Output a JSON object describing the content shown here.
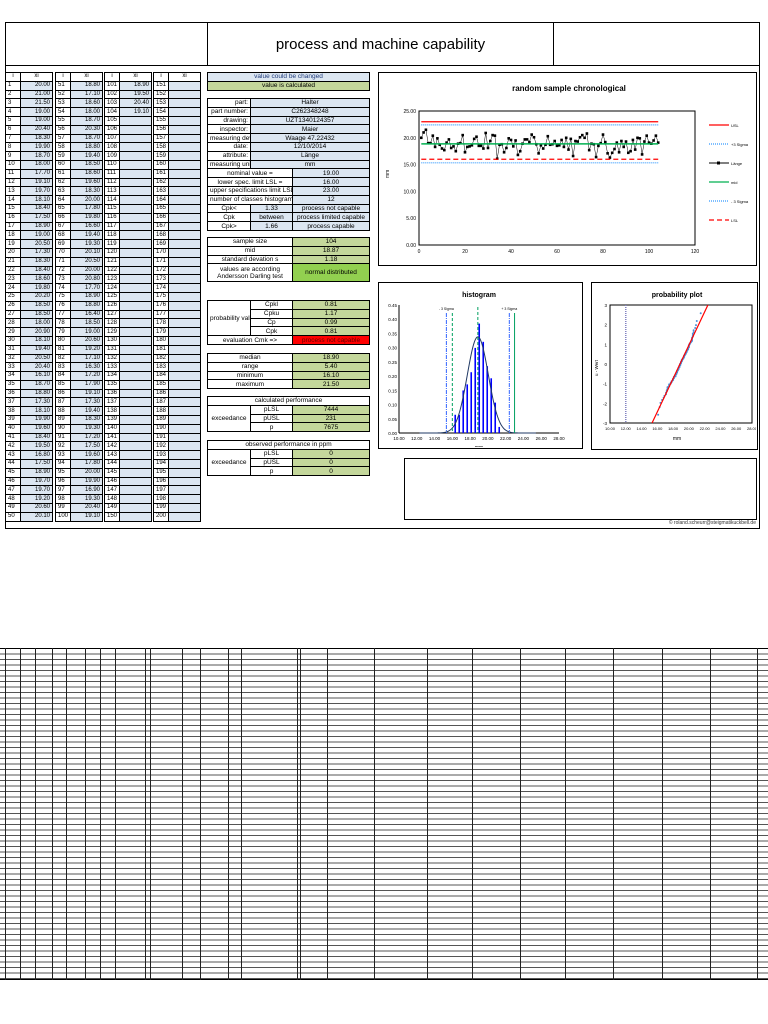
{
  "title": "process and machine capability",
  "table_headers": {
    "i": "i",
    "xi": "xi"
  },
  "measurements": [
    "20.00",
    "21.00",
    "21.50",
    "19.00",
    "19.00",
    "20.40",
    "18.30",
    "19.90",
    "18.70",
    "18.00",
    "17.70",
    "19.10",
    "19.70",
    "18.10",
    "18.40",
    "17.50",
    "18.90",
    "19.00",
    "20.50",
    "17.30",
    "18.30",
    "18.40",
    "18.60",
    "19.80",
    "20.20",
    "18.50",
    "18.50",
    "18.00",
    "20.90",
    "18.10",
    "19.40",
    "20.50",
    "20.40",
    "16.10",
    "18.70",
    "18.80",
    "17.30",
    "18.10",
    "19.90",
    "19.60",
    "18.40",
    "19.50",
    "16.80",
    "17.50",
    "18.90",
    "19.70",
    "19.70",
    "19.20",
    "20.60",
    "20.10",
    "18.80",
    "17.10",
    "18.60",
    "18.00",
    "18.70",
    "20.30",
    "18.70",
    "18.80",
    "19.40",
    "18.50",
    "18.60",
    "19.60",
    "18.30",
    "20.00",
    "17.80",
    "19.80",
    "16.60",
    "19.40",
    "19.30",
    "20.10",
    "20.50",
    "20.00",
    "20.80",
    "17.70",
    "18.90",
    "18.80",
    "16.40",
    "18.50",
    "19.00",
    "20.60",
    "19.20",
    "17.10",
    "16.30",
    "17.20",
    "17.90",
    "19.10",
    "17.30",
    "19.40",
    "18.30",
    "19.30",
    "17.20",
    "17.50",
    "19.60",
    "17.80",
    "20.00",
    "19.90",
    "16.90",
    "19.30",
    "20.40",
    "19.10",
    "18.90",
    "19.50",
    "20.40",
    "19.10"
  ],
  "legend_box": {
    "changeable": "value could be changed",
    "calculated": "value is calculated"
  },
  "part_info": [
    {
      "label": "part:",
      "value": "Halter"
    },
    {
      "label": "part number:",
      "value": "C262348248"
    },
    {
      "label": "drawing:",
      "value": "UZT1340124357"
    },
    {
      "label": "inspector:",
      "value": "Maier"
    },
    {
      "label": "measuring device:",
      "value": "Waage 47.22432"
    },
    {
      "label": "date:",
      "value": "12/10/2014"
    },
    {
      "label": "attribute:",
      "value": "Länge"
    },
    {
      "label": "measuring unit:",
      "value": "mm"
    }
  ],
  "spec": [
    {
      "label": "nominal value =",
      "value": "19.00"
    },
    {
      "label": "lower spec. limit LSL =",
      "value": "16.00"
    },
    {
      "label": "upper specifications limit LSL =",
      "value": "23.00"
    },
    {
      "label": "number of classes histogram =",
      "value": "12"
    }
  ],
  "cpk_eval": [
    {
      "label": "Cpk<",
      "value": "1.33",
      "result": "process not capable"
    },
    {
      "label": "Cpk",
      "value": "between",
      "result": "process limited capable"
    },
    {
      "label": "Cpk>",
      "value": "1.66",
      "result": "process capable"
    }
  ],
  "stats": [
    {
      "label": "sample size",
      "value": "104"
    },
    {
      "label": "mid",
      "value": "18.87"
    },
    {
      "label": "standard devation s",
      "value": "1.18"
    }
  ],
  "distribution": {
    "label": "values are according Andersson Darling test",
    "value": "normal distributed"
  },
  "probability_values": {
    "group_label": "probability values",
    "rows": [
      {
        "label": "Cpkl",
        "value": "0.81"
      },
      {
        "label": "Cpku",
        "value": "1.17"
      },
      {
        "label": "Cp",
        "value": "0.99"
      },
      {
        "label": "Cpk",
        "value": "0.81"
      }
    ]
  },
  "evaluation": {
    "label": "evaluation Cmk =>",
    "value": "process not capable"
  },
  "summary": [
    {
      "label": "median",
      "value": "18.90"
    },
    {
      "label": "range",
      "value": "5.40"
    },
    {
      "label": "minimum",
      "value": "16.10"
    },
    {
      "label": "maximum",
      "value": "21.50"
    }
  ],
  "calculated_performance": {
    "title": "calculated performance",
    "group_label": "exceedance",
    "rows": [
      {
        "label": "pLSL",
        "value": "7444"
      },
      {
        "label": "pUSL",
        "value": "231"
      },
      {
        "label": "p",
        "value": "7675"
      }
    ]
  },
  "observed_performance": {
    "title": "observed performance in ppm",
    "group_label": "exceedance",
    "rows": [
      {
        "label": "pLSL",
        "value": "0"
      },
      {
        "label": "pUSL",
        "value": "0"
      },
      {
        "label": "p",
        "value": "0"
      }
    ]
  },
  "copyright": "© roland.scheurr@steigmatikuckbell.de",
  "colors": {
    "input": "#dce6f1",
    "calculated": "#c4d79b",
    "ok": "#92d050",
    "bad": "#ff0000"
  },
  "chart_data": [
    {
      "type": "line",
      "title": "random sample chronological",
      "ylabel": "mm",
      "xlim": [
        0,
        120
      ],
      "ylim": [
        0,
        25
      ],
      "xticks": [
        "0",
        "20",
        "40",
        "60",
        "80",
        "100",
        "120"
      ],
      "yticks": [
        "0.00",
        "5.00",
        "10.00",
        "15.00",
        "20.00",
        "25.00"
      ],
      "series": [
        {
          "name": "USL",
          "value": 23.0,
          "color": "#ff0000"
        },
        {
          "name": "+3 Sigma",
          "value": 22.41,
          "color": "#3399ff"
        },
        {
          "name": "Länge",
          "values": "measurements",
          "color": "#000000"
        },
        {
          "name": "mid",
          "value": 18.87,
          "color": "#00b050"
        },
        {
          "name": "- 3 Sigma",
          "value": 15.33,
          "color": "#3399ff"
        },
        {
          "name": "LSL",
          "value": 16.0,
          "color": "#ff0000"
        }
      ]
    },
    {
      "type": "bar",
      "title": "histogram",
      "xlabel": "mm",
      "xlim": [
        10,
        28
      ],
      "ylim": [
        0,
        0.45
      ],
      "xticks": [
        "10.00",
        "12.00",
        "14.00",
        "16.00",
        "18.00",
        "20.00",
        "22.00",
        "24.00",
        "26.00",
        "28.00"
      ],
      "yticks": [
        "0.00",
        "0.05",
        "0.10",
        "0.15",
        "0.20",
        "0.25",
        "0.30",
        "0.35",
        "0.40",
        "0.45"
      ],
      "classes": 12,
      "mean": 18.87,
      "sd": 1.18,
      "markers": [
        {
          "name": "- 3 Sigma",
          "value": 15.33
        },
        {
          "name": "+ 3 Sigma",
          "value": 22.41
        },
        {
          "name": "LSL",
          "value": 16.0
        },
        {
          "name": "USL",
          "value": 23.0
        }
      ]
    },
    {
      "type": "scatter",
      "title": "probability plot",
      "xlabel": "mm",
      "ylabel": "u - Wert",
      "xlim": [
        10,
        28
      ],
      "ylim": [
        -3,
        3
      ],
      "xticks": [
        "10.00",
        "12.00",
        "14.00",
        "16.00",
        "18.00",
        "20.00",
        "22.00",
        "24.00",
        "26.00",
        "28.00"
      ],
      "yticks": [
        "-3",
        "-2",
        "-1",
        "0",
        "1",
        "2",
        "3"
      ],
      "mean": 18.87,
      "sd": 1.18
    }
  ]
}
